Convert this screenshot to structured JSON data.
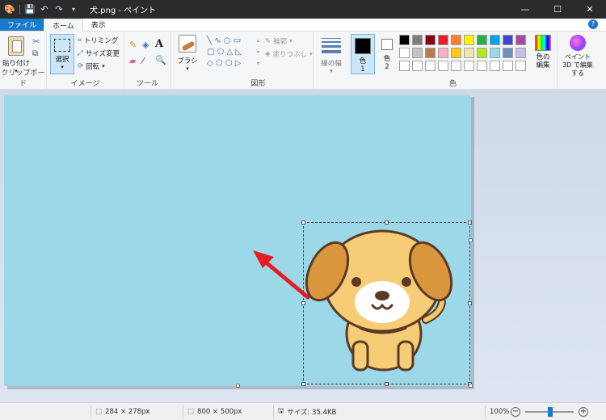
{
  "window": {
    "title": "犬.png - ペイント"
  },
  "tabs": [
    {
      "label": "ファイル"
    },
    {
      "label": "ホーム"
    },
    {
      "label": "表示"
    }
  ],
  "ribbon": {
    "clipboard": {
      "paste": "貼り付け",
      "label": "クリップボード"
    },
    "image": {
      "select": "選択",
      "crop": "トリミング",
      "resize": "サイズ変更",
      "rotate": "回転",
      "label": "イメージ"
    },
    "tools": {
      "label": "ツール"
    },
    "brushes": {
      "label": "ブラシ"
    },
    "shapes": {
      "outline": "輪郭",
      "fill": "塗りつぶし",
      "label": "図形"
    },
    "size": {
      "label": "線の幅"
    },
    "colors": {
      "color1": "色",
      "color1_num": "1",
      "color2": "色",
      "color2_num": "2",
      "edit": "色の編集",
      "label": "色",
      "color1_value": "#000000",
      "color2_value": "#ffffff",
      "palette": [
        "#000000",
        "#7f7f7f",
        "#880015",
        "#ed1c24",
        "#ff7f27",
        "#fff200",
        "#22b14c",
        "#00a2e8",
        "#3f48cc",
        "#a349a4",
        "#ffffff",
        "#c3c3c3",
        "#b97a57",
        "#ffaec9",
        "#ffc90e",
        "#efe4b0",
        "#b5e61d",
        "#99d9ea",
        "#7092be",
        "#c8bfe7"
      ]
    },
    "paint3d": {
      "label": "ペイント 3D で編集する"
    }
  },
  "canvas": {
    "background": "#9cd8e7"
  },
  "statusbar": {
    "selection_size": "284 × 278px",
    "image_size": "800 × 500px",
    "file_size": "サイズ: 35.4KB",
    "zoom": "100%"
  }
}
